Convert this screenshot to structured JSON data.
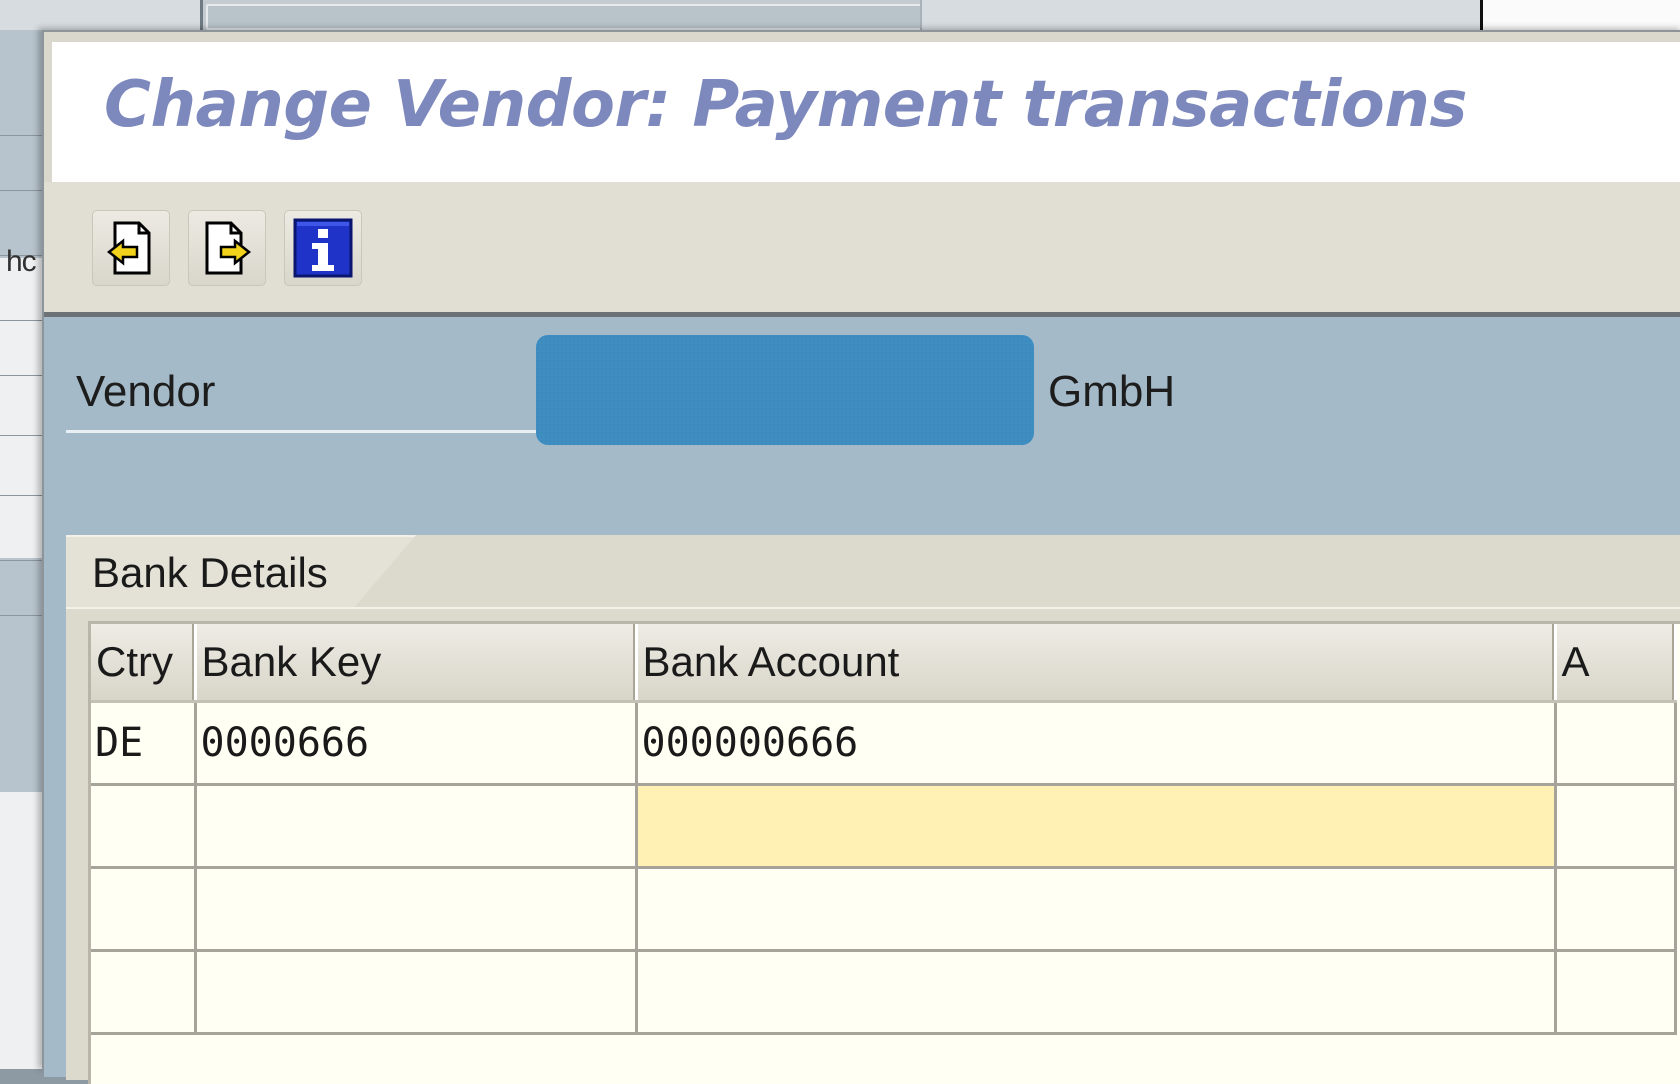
{
  "background": {
    "partial_label": "hc"
  },
  "dialog": {
    "title": "Change Vendor: Payment transactions"
  },
  "toolbar": {
    "buttons": [
      {
        "name": "previous-screen",
        "icon": "previous-page-icon"
      },
      {
        "name": "next-screen",
        "icon": "next-page-icon"
      },
      {
        "name": "information",
        "icon": "info-icon"
      }
    ]
  },
  "vendor": {
    "label": "Vendor",
    "value_redacted": true,
    "name_suffix": "GmbH"
  },
  "tabs": [
    {
      "label": "Bank Details",
      "active": true
    }
  ],
  "bank_table": {
    "columns": [
      "Ctry",
      "Bank Key",
      "Bank Account",
      "A"
    ],
    "rows": [
      [
        "DE",
        "0000666",
        "000000666",
        ""
      ],
      [
        "",
        "",
        "",
        ""
      ],
      [
        "",
        "",
        "",
        ""
      ],
      [
        "",
        "",
        "",
        ""
      ]
    ]
  },
  "colors": {
    "title": "#7d88bd",
    "content_bg": "#a4bac9",
    "redaction": "#3f8ec2",
    "focused_cell": "#fff0b3"
  }
}
